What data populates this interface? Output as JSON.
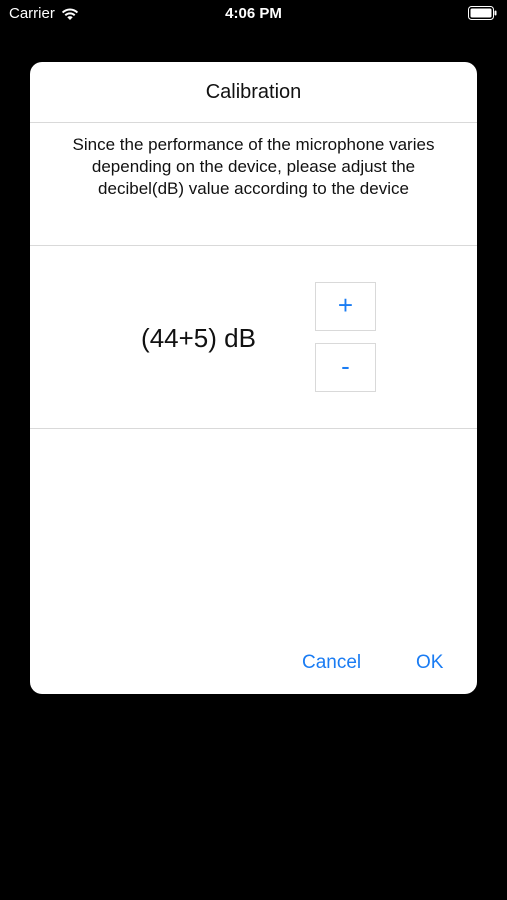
{
  "status_bar": {
    "carrier": "Carrier",
    "time": "4:06 PM",
    "icons": [
      "wifi-icon",
      "battery-icon"
    ]
  },
  "dialog": {
    "title": "Calibration",
    "message": "Since the performance of the microphone varies depending on the device, please adjust the decibel(dB) value according to the device",
    "db_value": "(44+5) dB",
    "plus_label": "+",
    "minus_label": "-",
    "cancel_label": "Cancel",
    "ok_label": "OK"
  },
  "colors": {
    "accent": "#1a7cf3",
    "background": "#000000",
    "dialog_background": "#ffffff",
    "divider": "#d9d9d9"
  }
}
